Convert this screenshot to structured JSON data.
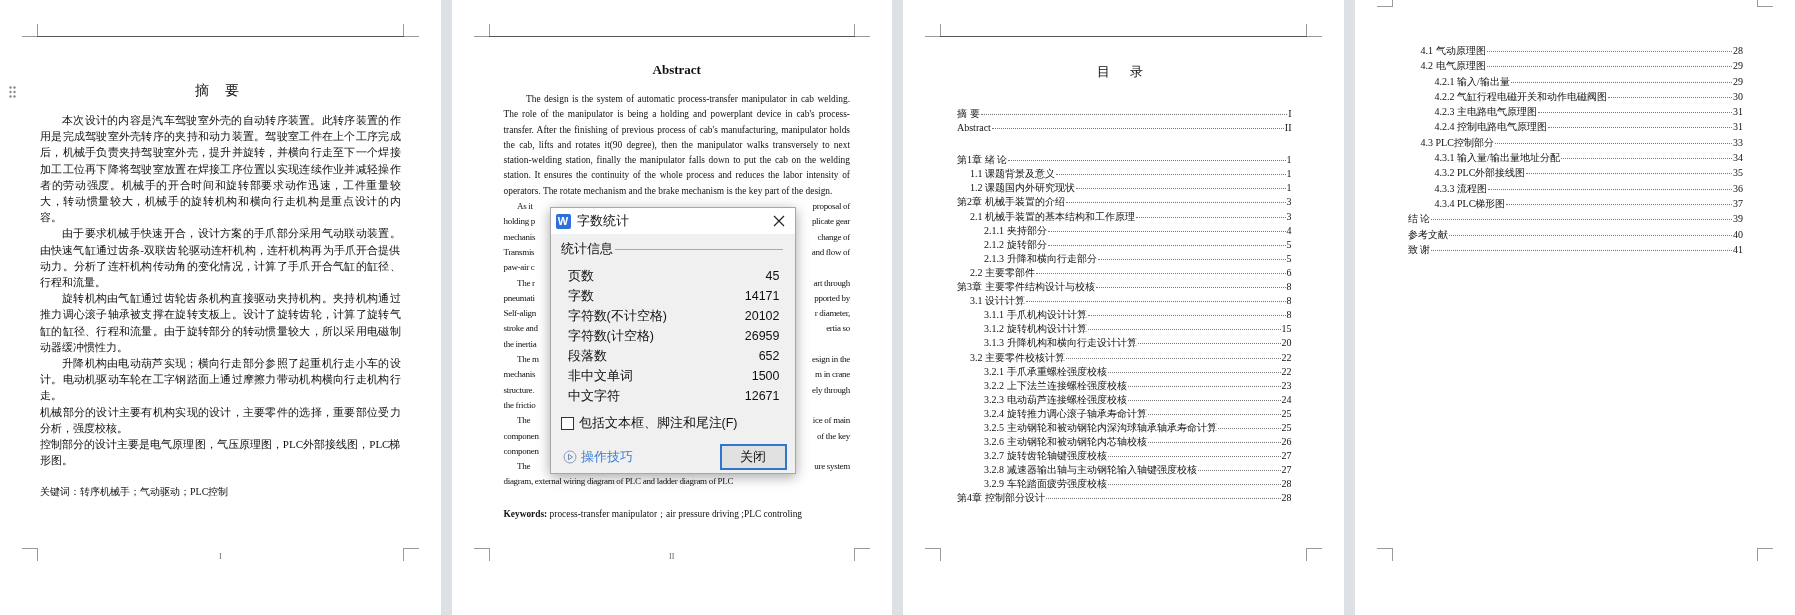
{
  "pages": [
    {
      "kind": "abstract_cn",
      "title": "摘 要",
      "paragraphs": [
        {
          "indent": true,
          "text": "本次设计的内容是汽车驾驶室外壳的自动转序装置。此转序装置的作用是完成驾驶室外壳转序的夹持和动力装置。驾驶室工件在上个工序完成后，机械手负责夹持驾驶室外壳，提升并旋转，并横向行走至下一个焊接加工工位再下降将驾驶室放置在焊接工序位置以实现连续作业并减轻操作者的劳动强度。机械手的开合时间和旋转部要求动作迅速，工件重量较大，转动惯量较大，机械手的旋转机构和横向行走机构是重点设计的内容。"
        },
        {
          "indent": true,
          "text": "由于要求机械手快速开合，设计方案的手爪部分采用气动联动装置。由快速气缸通过齿条-双联齿轮驱动连杆机构，连杆机构再为手爪开合提供动力。分析了连杆机构传动角的变化情况，计算了手爪开合气缸的缸径、行程和流量。"
        },
        {
          "indent": true,
          "text": "旋转机构由气缸通过齿轮齿条机构直接驱动夹持机构。夹持机构通过推力调心滚子轴承被支撑在旋转支板上。设计了旋转齿轮，计算了旋转气缸的缸径、行程和流量。由于旋转部分的转动惯量较大，所以采用电磁制动器缓冲惯性力。"
        },
        {
          "indent": true,
          "text": "升降机构由电动葫芦实现；横向行走部分参照了起重机行走小车的设计。电动机驱动车轮在工字钢踏面上通过摩擦力带动机构横向行走机构行走。"
        },
        {
          "indent": false,
          "text": "机械部分的设计主要有机构实现的设计，主要零件的选择，重要部位受力分析，强度校核。"
        },
        {
          "indent": false,
          "text": "控制部分的设计主要是电气原理图，气压原理图，PLC外部接线图，PLC梯形图。"
        }
      ],
      "keywords": "关键词：转序机械手；气动驱动；PLC控制",
      "footer": "I"
    },
    {
      "kind": "abstract_en",
      "title": "Abstract",
      "paragraphs": [
        {
          "text": "The design is the system of automatic process-transfer manipulator in cab welding. The role of the manipulator is being a holding and powerplant device in cab's process-transfer. After the finishing of previous process of cab's manufacturing, manipulator holds the cab, lifts and rotates it(90 degree), then the manipulator walks transversely to next station-welding station, finally the manipulator falls down to put the cab on the welding station. It ensures the continuity of the whole process and reduces the labor intensity of operators. The rotate mechanism and the brake mechanism is the key part of the design."
        },
        {
          "lines": [
            {
              "left": "As it",
              "right": "proposal of"
            },
            {
              "left": "holding p",
              "right": "plicate gear"
            },
            {
              "left": "mechanis",
              "right": "change of"
            },
            {
              "left": "Transmis",
              "right": "and flow of"
            },
            {
              "left": "paw-air c"
            }
          ]
        },
        {
          "lines": [
            {
              "left": "The r",
              "right": "art through"
            },
            {
              "left": "pneumati",
              "right": "pported by"
            },
            {
              "left": "Self-align",
              "right": "r diameter,"
            },
            {
              "left": "stroke and",
              "right": "ertia so"
            },
            {
              "left": "the inertia"
            }
          ]
        },
        {
          "lines": [
            {
              "left": "The m",
              "right": "esign in the"
            },
            {
              "left": "mechanis",
              "right": "m in crane"
            },
            {
              "left": "structure.",
              "right": "ely through"
            },
            {
              "left": "the frictio"
            }
          ]
        },
        {
          "lines": [
            {
              "left": "The",
              "right": "ice of main"
            },
            {
              "left": "componen",
              "right": "of the key"
            },
            {
              "left": "componen"
            }
          ]
        },
        {
          "lines": [
            {
              "left": "The",
              "right": "ure system"
            },
            {
              "left": "diagram, external wiring diagram of PLC and ladder diagram of PLC"
            }
          ]
        }
      ],
      "keywords": "**Keywords:** process-transfer manipulator；air pressure driving ;PLC controling",
      "footer": "II"
    },
    {
      "kind": "toc",
      "title": "目 录",
      "front": [
        {
          "title": "摘 要",
          "page": "I"
        },
        {
          "title": "Abstract",
          "page": "II"
        }
      ],
      "entries": [
        {
          "title": "第1章 绪 论",
          "page": "1",
          "children": [
            {
              "title": "1.1 课题背景及意义",
              "page": "1"
            },
            {
              "title": "1.2 课题国内外研究现状",
              "page": "1"
            }
          ]
        },
        {
          "title": "第2章 机械手装置的介绍",
          "page": "3",
          "children": [
            {
              "title": "2.1 机械手装置的基本结构和工作原理",
              "page": "3",
              "children": [
                {
                  "title": "2.1.1 夹持部分",
                  "page": "4"
                },
                {
                  "title": "2.1.2 旋转部分",
                  "page": "5"
                },
                {
                  "title": "2.1.3 升降和横向行走部分",
                  "page": "5"
                }
              ]
            },
            {
              "title": "2.2 主要零部件",
              "page": "6"
            }
          ]
        },
        {
          "title": "第3章 主要零件结构设计与校核",
          "page": "8",
          "children": [
            {
              "title": "3.1 设计计算",
              "page": "8",
              "children": [
                {
                  "title": "3.1.1 手爪机构设计计算",
                  "page": "8"
                },
                {
                  "title": "3.1.2 旋转机构设计计算",
                  "page": "15"
                },
                {
                  "title": "3.1.3 升降机构和横向行走设计计算",
                  "page": "20"
                }
              ]
            },
            {
              "title": "3.2 主要零件校核计算",
              "page": "22",
              "children": [
                {
                  "title": "3.2.1 手爪承重螺栓强度校核",
                  "page": "22"
                },
                {
                  "title": "3.2.2 上下法兰连接螺栓强度校核",
                  "page": "23"
                },
                {
                  "title": "3.2.3 电动葫芦连接螺栓强度校核",
                  "page": "24"
                },
                {
                  "title": "3.2.4 旋转推力调心滚子轴承寿命计算",
                  "page": "25"
                },
                {
                  "title": "3.2.5 主动钢轮和被动钢轮内深沟球轴承轴承寿命计算",
                  "page": "25"
                },
                {
                  "title": "3.2.6 主动钢轮和被动钢轮内芯轴校核",
                  "page": "26"
                },
                {
                  "title": "3.2.7 旋转齿轮轴键强度校核",
                  "page": "27"
                },
                {
                  "title": "3.2.8 减速器输出轴与主动钢轮输入轴键强度校核",
                  "page": "27"
                },
                {
                  "title": "3.2.9 车轮踏面疲劳强度校核",
                  "page": "28"
                }
              ]
            }
          ]
        },
        {
          "title": "第4章 控制部分设计",
          "page": "28"
        }
      ]
    },
    {
      "kind": "toc_continued",
      "entries": [
        {
          "children": [
            {
              "title": "4.1 气动原理图",
              "page": "28"
            },
            {
              "title": "4.2 电气原理图",
              "page": "29",
              "children": [
                {
                  "title": "4.2.1 输入/输出量",
                  "page": "29"
                },
                {
                  "title": "4.2.2 气缸行程电磁开关和动作电磁阀图",
                  "page": "30"
                },
                {
                  "title": "4.2.3 主电路电气原理图",
                  "page": "31"
                },
                {
                  "title": "4.2.4 控制电路电气原理图",
                  "page": "31"
                }
              ]
            },
            {
              "title": "4.3 PLC控制部分",
              "page": "33",
              "children": [
                {
                  "title": "4.3.1 输入量/输出量地址分配",
                  "page": "34"
                },
                {
                  "title": "4.3.2 PLC外部接线图",
                  "page": "35"
                },
                {
                  "title": "4.3.3 流程图",
                  "page": "36"
                },
                {
                  "title": "4.3.4 PLC梯形图",
                  "page": "37"
                }
              ]
            }
          ]
        },
        {
          "title": "结 论",
          "page": "39"
        },
        {
          "title": "参考文献",
          "page": "40"
        },
        {
          "title": "致 谢",
          "page": "41"
        }
      ]
    }
  ],
  "dialog": {
    "app_letter": "W",
    "title": "字数统计",
    "group": "统计信息",
    "stats": [
      {
        "label": "页数",
        "value": "45"
      },
      {
        "label": "字数",
        "value": "14171"
      },
      {
        "label": "字符数(不计空格)",
        "value": "20102"
      },
      {
        "label": "字符数(计空格)",
        "value": "26959"
      },
      {
        "label": "段落数",
        "value": "652"
      },
      {
        "label": "非中文单词",
        "value": "1500"
      },
      {
        "label": "中文字符",
        "value": "12671"
      }
    ],
    "checkbox": {
      "label": "包括文本框、脚注和尾注(F)",
      "checked": false
    },
    "tips_link": "操作技巧",
    "close_button": {
      "label": "关闭",
      "focused": true
    }
  }
}
